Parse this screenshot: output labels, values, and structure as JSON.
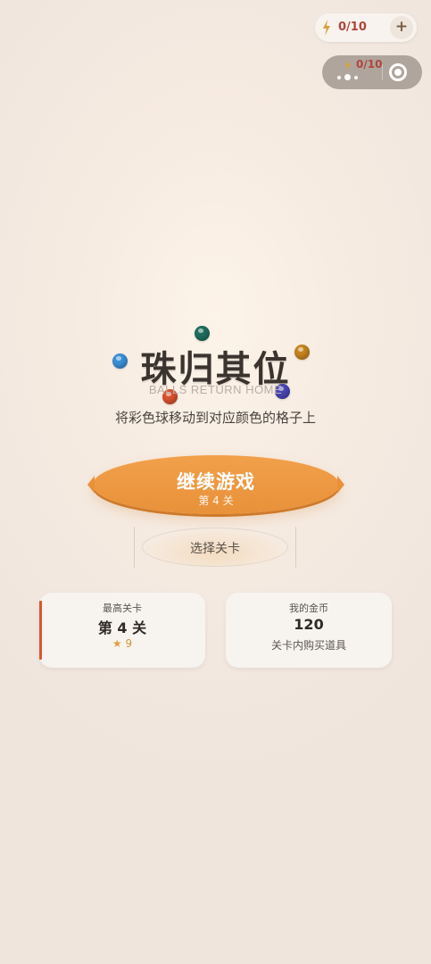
{
  "energy": {
    "count": "0/10",
    "plus_label": "+"
  },
  "capsule": {
    "count": "0/10"
  },
  "title": {
    "main": "珠归其位",
    "subtitle": "BALLS RETURN HOME",
    "description": "将彩色球移动到对应颜色的格子上"
  },
  "title_balls": [
    {
      "name": "teal-ball",
      "color": "#1f6e5d"
    },
    {
      "name": "blue-ball",
      "color": "#3b8fd8"
    },
    {
      "name": "gold-ball",
      "color": "#c6841f"
    },
    {
      "name": "red-ball",
      "color": "#d8532f"
    },
    {
      "name": "indigo-ball",
      "color": "#4a46b5"
    }
  ],
  "continue_button": {
    "label": "继续游戏",
    "sub": "第 4 关"
  },
  "select_button": {
    "label": "选择关卡"
  },
  "stats": {
    "best": {
      "title": "最高关卡",
      "value": "第 4 关",
      "stars": "9",
      "star_icon": "★"
    },
    "coins": {
      "title": "我的金币",
      "value": "120",
      "note": "关卡内购买道具"
    }
  },
  "colors": {
    "accent": "#e8913a",
    "energy_text": "#b0453c",
    "card_accent": "#d9582f"
  }
}
